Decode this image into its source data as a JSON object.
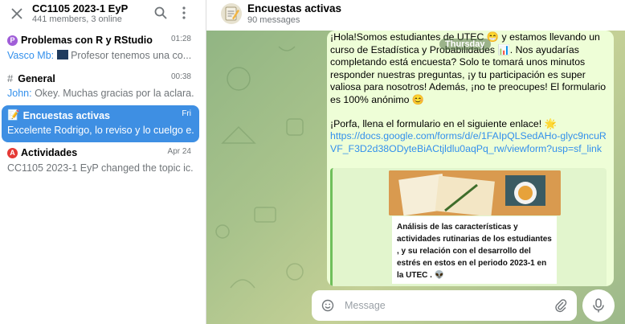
{
  "group": {
    "title": "CC1105 2023-1 EyP",
    "members": "441 members, 3 online"
  },
  "topics": [
    {
      "icon": "purple-circle-icon",
      "icon_letter": "P",
      "color": "#a05ed8",
      "title": "Problemas con R y RStudio",
      "date": "01:28",
      "sender": "Vasco Mb:",
      "preview": "Profesor tenemos una co..."
    },
    {
      "icon": "hash-icon",
      "icon_letter": "#",
      "title": "General",
      "date": "00:38",
      "sender": "John:",
      "preview": "Okey. Muchas gracias por la aclara..."
    },
    {
      "icon": "memo-icon",
      "title": "Encuestas activas",
      "date": "Fri",
      "sender": "",
      "preview": "Excelente Rodrigo, lo reviso y lo cuelgo e..."
    },
    {
      "icon": "red-a-icon",
      "icon_letter": "A",
      "color": "#e53935",
      "title": "Actividades",
      "date": "Apr 24",
      "sender": "",
      "preview": "CC1105 2023-1 EyP changed the topic ic..."
    }
  ],
  "chat": {
    "title": "Encuestas activas",
    "subtitle": "90 messages",
    "day_badge": "Thursday"
  },
  "message": {
    "p1": "¡Hola!Somos estudiantes de UTEC 😁 y estamos llevando un curso de Estadística y Probabilidades 📊. Nos ayudarías completando está encuesta? Solo te tomará unos minutos responder nuestras preguntas, ¡y tu participación es super valiosa para nosotros! Además, ¡no te preocupes! El formulario es 100% anónimo 😊",
    "p2": "¡Porfa, llena el formulario en el siguiente enlace! 🌟",
    "link": "https://docs.google.com/forms/d/e/1FAIpQLSedAHo-glyc9ncuRVF_F3D2d38ODyteBiACtjldlu0aqPq_rw/viewform?usp=sf_link",
    "preview_text": "Análisis de las características y actividades rutinarias de los estudiantes , y su relación con el desarrollo del estrés en estos en el periodo 2023-1 en la UTEC . 👽"
  },
  "composer": {
    "placeholder": "Message"
  },
  "colors": {
    "accent": "#3e8fe3",
    "link": "#3390ec",
    "bubble": "#eefed7"
  }
}
